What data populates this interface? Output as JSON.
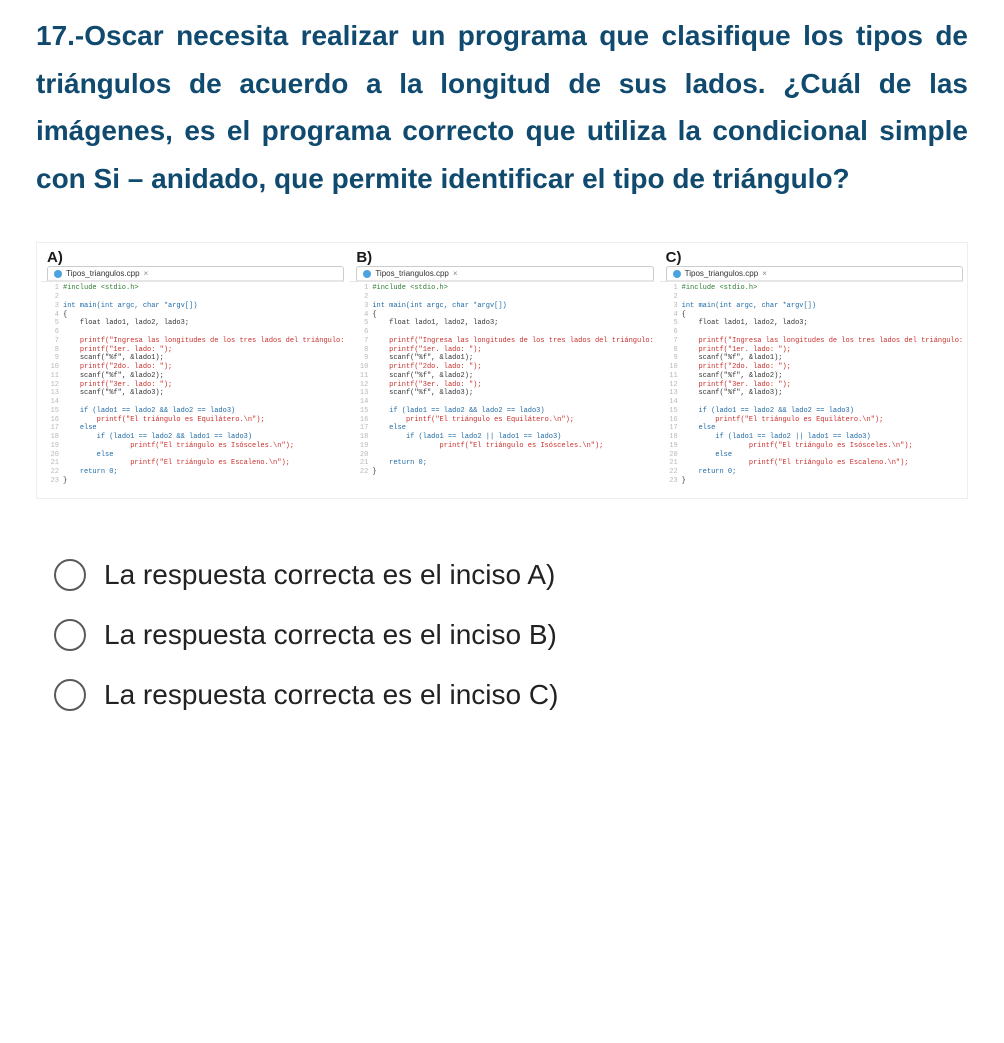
{
  "question_text": "17.-Oscar necesita realizar un programa que clasifique los tipos de triángulos de acuerdo a la longitud de sus lados. ¿Cuál de las imágenes, es el programa correcto que utiliza la condicional simple con Si – anidado, que permite identificar el tipo de triángulo?",
  "columns": {
    "a": {
      "label": "A)",
      "tab": "Tipos_triangulos.cpp"
    },
    "b": {
      "label": "B)",
      "tab": "Tipos_triangulos.cpp"
    },
    "c": {
      "label": "C)",
      "tab": "Tipos_triangulos.cpp"
    }
  },
  "code": {
    "include": "#include <stdio.h>",
    "main_sig": "int main(int argc, char *argv[])",
    "decl": "float lado1, lado2, lado3;",
    "p_intro": "printf(\"Ingresa las longitudes de los tres lados del triángulo:\\n\");",
    "p_l1": "printf(\"1er. lado: \");",
    "s_l1": "scanf(\"%f\", &lado1);",
    "p_l2": "printf(\"2do. lado: \");",
    "s_l2": "scanf(\"%f\", &lado2);",
    "p_l3": "printf(\"3er. lado: \");",
    "s_l3": "scanf(\"%f\", &lado3);",
    "a_if1": "if (lado1 == lado2 && lado2 == lado3)",
    "a_eq": "    printf(\"El triángulo es Equilátero.\\n\");",
    "a_else": "else",
    "a_if2": "    if (lado1 == lado2 && lado1 == lado3)",
    "a_iso": "        printf(\"El triángulo es Isósceles.\\n\");",
    "a_else2": "    else",
    "a_esc": "        printf(\"El triángulo es Escaleno.\\n\");",
    "a_ret": "return 0;",
    "b_if1": "if (lado1 == lado2 && lado2 == lado3)",
    "b_eq": "    printf(\"El triángulo es Equilátero.\\n\");",
    "b_else": "else",
    "b_if2": "    if (lado1 == lado2 || lado1 == lado3)",
    "b_iso": "        printf(\"El triángulo es Isósceles.\\n\");",
    "b_ret": "return 0;",
    "c_if1": "if (lado1 == lado2 && lado2 == lado3)",
    "c_eq": "    printf(\"El triángulo es Equilátero.\\n\");",
    "c_else": "else",
    "c_if2": "    if (lado1 == lado2 || lado1 == lado3)",
    "c_iso": "        printf(\"El triángulo es Isósceles.\\n\");",
    "c_else2": "    else",
    "c_esc": "        printf(\"El triángulo es Escaleno.\\n\");",
    "c_ret": "return 0;"
  },
  "tab_close_glyph": "×",
  "options": {
    "a": "La respuesta correcta es el inciso A)",
    "b": "La respuesta correcta es el inciso B)",
    "c": "La respuesta correcta es el inciso C)"
  }
}
